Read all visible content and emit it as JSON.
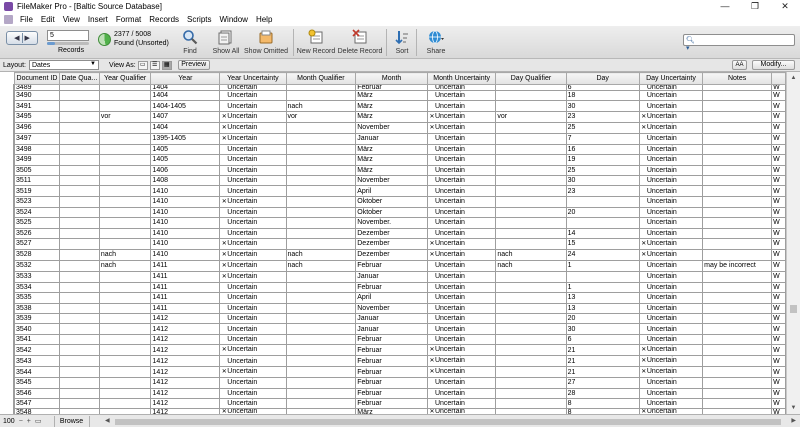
{
  "window": {
    "title": "FileMaker Pro - [Baltic Source Database]",
    "controls": [
      "—",
      "❐",
      "✕"
    ]
  },
  "menu": [
    "File",
    "Edit",
    "View",
    "Insert",
    "Format",
    "Records",
    "Scripts",
    "Window",
    "Help"
  ],
  "toolbar": {
    "record_number": "5",
    "records_label": "Records",
    "found_count": "2377 / 5008",
    "found_status": "Found (Unsorted)",
    "found_ratio": 0.47,
    "buttons": {
      "find": "Find",
      "show_all": "Show All",
      "show_omitted": "Show Omitted",
      "new_record": "New Record",
      "delete_record": "Delete Record",
      "sort": "Sort",
      "share": "Share"
    }
  },
  "layoutbar": {
    "layout_label": "Layout:",
    "layout_value": "Dates",
    "view_as_label": "View As:",
    "preview_label": "Preview",
    "aa_label": "AA",
    "modify_label": "Modify..."
  },
  "table": {
    "columns": [
      "Document ID",
      "Date Qua...",
      "Year Qualifier",
      "Year",
      "Year Uncertainty",
      "Month Qualifier",
      "Month",
      "Month Uncertainty",
      "Day Qualifier",
      "Day",
      "Day Uncertainty",
      "Notes"
    ],
    "rows": [
      {
        "id": "3489",
        "yq": "",
        "year": "1404",
        "yu": false,
        "mq": "",
        "month": "Februar",
        "mu": false,
        "dq": "",
        "day": "6",
        "du": false,
        "notes": ""
      },
      {
        "id": "3490",
        "yq": "",
        "year": "1404",
        "yu": false,
        "mq": "",
        "month": "März",
        "mu": false,
        "dq": "",
        "day": "18",
        "du": false,
        "notes": ""
      },
      {
        "id": "3491",
        "yq": "",
        "year": "1404-1405",
        "yu": false,
        "mq": "nach",
        "month": "März",
        "mu": false,
        "dq": "",
        "day": "30",
        "du": false,
        "notes": ""
      },
      {
        "id": "3495",
        "yq": "vor",
        "year": "1407",
        "yu": true,
        "mq": "vor",
        "month": "März",
        "mu": true,
        "dq": "vor",
        "day": "23",
        "du": true,
        "notes": ""
      },
      {
        "id": "3496",
        "yq": "",
        "year": "1404",
        "yu": true,
        "mq": "",
        "month": "November",
        "mu": true,
        "dq": "",
        "day": "25",
        "du": true,
        "notes": ""
      },
      {
        "id": "3497",
        "yq": "",
        "year": "1395-1405",
        "yu": true,
        "mq": "",
        "month": "Januar",
        "mu": false,
        "dq": "",
        "day": "7",
        "du": false,
        "notes": ""
      },
      {
        "id": "3498",
        "yq": "",
        "year": "1405",
        "yu": false,
        "mq": "",
        "month": "März",
        "mu": false,
        "dq": "",
        "day": "16",
        "du": false,
        "notes": ""
      },
      {
        "id": "3499",
        "yq": "",
        "year": "1405",
        "yu": false,
        "mq": "",
        "month": "März",
        "mu": false,
        "dq": "",
        "day": "19",
        "du": false,
        "notes": ""
      },
      {
        "id": "3505",
        "yq": "",
        "year": "1406",
        "yu": false,
        "mq": "",
        "month": "März",
        "mu": false,
        "dq": "",
        "day": "25",
        "du": false,
        "notes": ""
      },
      {
        "id": "3511",
        "yq": "",
        "year": "1408",
        "yu": false,
        "mq": "",
        "month": "November",
        "mu": false,
        "dq": "",
        "day": "30",
        "du": false,
        "notes": ""
      },
      {
        "id": "3519",
        "yq": "",
        "year": "1410",
        "yu": false,
        "mq": "",
        "month": "April",
        "mu": false,
        "dq": "",
        "day": "23",
        "du": false,
        "notes": ""
      },
      {
        "id": "3523",
        "yq": "",
        "year": "1410",
        "yu": true,
        "mq": "",
        "month": "Oktober",
        "mu": false,
        "dq": "",
        "day": "",
        "du": false,
        "notes": ""
      },
      {
        "id": "3524",
        "yq": "",
        "year": "1410",
        "yu": false,
        "mq": "",
        "month": "Oktober",
        "mu": false,
        "dq": "",
        "day": "20",
        "du": false,
        "notes": ""
      },
      {
        "id": "3525",
        "yq": "",
        "year": "1410",
        "yu": false,
        "mq": "",
        "month": "November.",
        "mu": false,
        "dq": "",
        "day": "",
        "du": false,
        "notes": ""
      },
      {
        "id": "3526",
        "yq": "",
        "year": "1410",
        "yu": false,
        "mq": "",
        "month": "Dezember",
        "mu": false,
        "dq": "",
        "day": "14",
        "du": false,
        "notes": ""
      },
      {
        "id": "3527",
        "yq": "",
        "year": "1410",
        "yu": true,
        "mq": "",
        "month": "Dezember",
        "mu": true,
        "dq": "",
        "day": "15",
        "du": true,
        "notes": ""
      },
      {
        "id": "3528",
        "yq": "nach",
        "year": "1410",
        "yu": true,
        "mq": "nach",
        "month": "Dezember",
        "mu": true,
        "dq": "nach",
        "day": "24",
        "du": true,
        "notes": ""
      },
      {
        "id": "3532",
        "yq": "nach",
        "year": "1411",
        "yu": true,
        "mq": "nach",
        "month": "Februar",
        "mu": false,
        "dq": "nach",
        "day": "1",
        "du": false,
        "notes": "may be incorrect"
      },
      {
        "id": "3533",
        "yq": "",
        "year": "1411",
        "yu": true,
        "mq": "",
        "month": "Januar",
        "mu": false,
        "dq": "",
        "day": "",
        "du": false,
        "notes": ""
      },
      {
        "id": "3534",
        "yq": "",
        "year": "1411",
        "yu": false,
        "mq": "",
        "month": "Februar",
        "mu": false,
        "dq": "",
        "day": "1",
        "du": false,
        "notes": ""
      },
      {
        "id": "3535",
        "yq": "",
        "year": "1411",
        "yu": false,
        "mq": "",
        "month": "April",
        "mu": false,
        "dq": "",
        "day": "13",
        "du": false,
        "notes": ""
      },
      {
        "id": "3538",
        "yq": "",
        "year": "1411",
        "yu": false,
        "mq": "",
        "month": "November",
        "mu": false,
        "dq": "",
        "day": "13",
        "du": false,
        "notes": ""
      },
      {
        "id": "3539",
        "yq": "",
        "year": "1412",
        "yu": false,
        "mq": "",
        "month": "Januar",
        "mu": false,
        "dq": "",
        "day": "20",
        "du": false,
        "notes": ""
      },
      {
        "id": "3540",
        "yq": "",
        "year": "1412",
        "yu": false,
        "mq": "",
        "month": "Januar",
        "mu": false,
        "dq": "",
        "day": "30",
        "du": false,
        "notes": ""
      },
      {
        "id": "3541",
        "yq": "",
        "year": "1412",
        "yu": false,
        "mq": "",
        "month": "Februar",
        "mu": false,
        "dq": "",
        "day": "6",
        "du": false,
        "notes": ""
      },
      {
        "id": "3542",
        "yq": "",
        "year": "1412",
        "yu": true,
        "mq": "",
        "month": "Februar",
        "mu": true,
        "dq": "",
        "day": "21",
        "du": true,
        "notes": ""
      },
      {
        "id": "3543",
        "yq": "",
        "year": "1412",
        "yu": false,
        "mq": "",
        "month": "Februar",
        "mu": true,
        "dq": "",
        "day": "21",
        "du": true,
        "notes": ""
      },
      {
        "id": "3544",
        "yq": "",
        "year": "1412",
        "yu": true,
        "mq": "",
        "month": "Februar",
        "mu": true,
        "dq": "",
        "day": "21",
        "du": true,
        "notes": ""
      },
      {
        "id": "3545",
        "yq": "",
        "year": "1412",
        "yu": false,
        "mq": "",
        "month": "Februar",
        "mu": false,
        "dq": "",
        "day": "27",
        "du": false,
        "notes": ""
      },
      {
        "id": "3546",
        "yq": "",
        "year": "1412",
        "yu": false,
        "mq": "",
        "month": "Februar",
        "mu": false,
        "dq": "",
        "day": "28",
        "du": false,
        "notes": ""
      },
      {
        "id": "3547",
        "yq": "",
        "year": "1412",
        "yu": false,
        "mq": "",
        "month": "Februar",
        "mu": false,
        "dq": "",
        "day": "8",
        "du": false,
        "notes": ""
      },
      {
        "id": "3548",
        "yq": "",
        "year": "1412",
        "yu": true,
        "mq": "",
        "month": "März",
        "mu": true,
        "dq": "",
        "day": "8",
        "du": true,
        "notes": ""
      }
    ],
    "uncertain_text": "Uncertain",
    "overflow_glyph": "W"
  },
  "statusbar": {
    "zoom": "100",
    "mode": "Browse"
  }
}
